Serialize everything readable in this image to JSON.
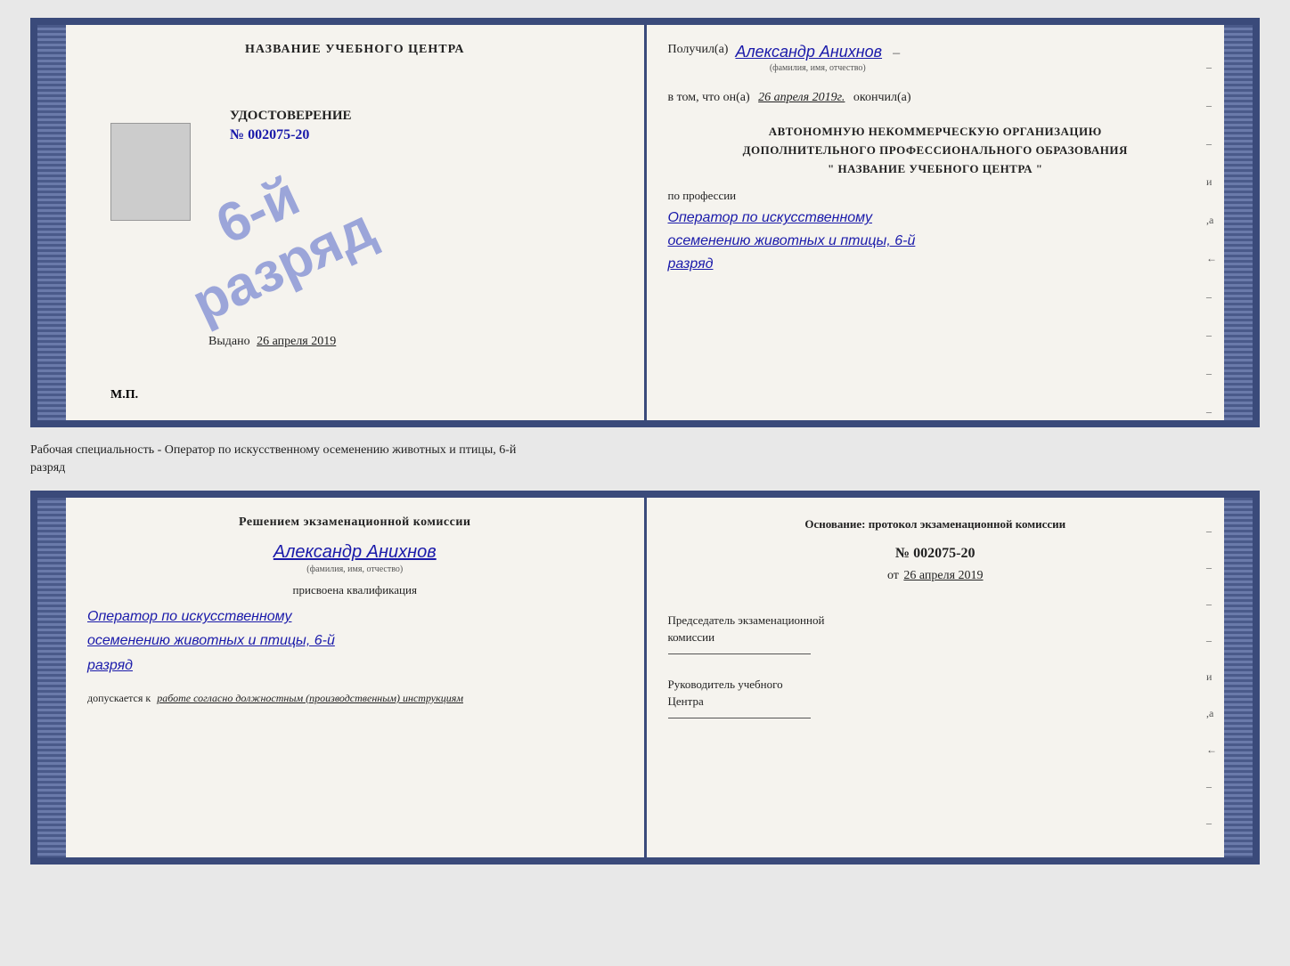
{
  "top_doc": {
    "left": {
      "header": "НАЗВАНИЕ УЧЕБНОГО ЦЕНТРА",
      "udostoverenie_label": "УДОСТОВЕРЕНИЕ",
      "number": "№ 002075-20",
      "vydano_label": "Выдано",
      "vydano_date": "26 апреля 2019",
      "mp_label": "М.П.",
      "stamp_line1": "6-й",
      "stamp_line2": "разряд"
    },
    "right": {
      "poluchil_prefix": "Получил(а)",
      "poluchil_name": "Александр Анихнов",
      "fio_subtitle": "(фамилия, имя, отчество)",
      "dash1": "–",
      "vtom_prefix": "в том, что он(а)",
      "vtom_date": "26 апреля 2019г.",
      "okkonchil": "окончил(а)",
      "org_line1": "АВТОНОМНУЮ НЕКОММЕРЧЕСКУЮ ОРГАНИЗАЦИЮ",
      "org_line2": "ДОПОЛНИТЕЛЬНОГО ПРОФЕССИОНАЛЬНОГО ОБРАЗОВАНИЯ",
      "org_line3": "\"  НАЗВАНИЕ УЧЕБНОГО ЦЕНТРА  \"",
      "po_professii": "по профессии",
      "professiya1": "Оператор по искусственному",
      "professiya2": "осеменению животных и птицы, 6-й",
      "professiya3": "разряд",
      "dashes": [
        "–",
        "–",
        "–",
        "и",
        ",а",
        "←",
        "–",
        "–",
        "–",
        "–"
      ]
    }
  },
  "between_label": "Рабочая специальность - Оператор по искусственному осеменению животных и птицы, 6-й\nразряд",
  "bottom_doc": {
    "left": {
      "resheniyem": "Решением экзаменационной комиссии",
      "person_name": "Александр Анихнов",
      "fio_subtitle": "(фамилия, имя, отчество)",
      "prisvoena": "присвоена квалификация",
      "kvali1": "Оператор по искусственному",
      "kvali2": "осеменению животных и птицы, 6-й",
      "kvali3": "разряд",
      "dopusk_prefix": "допускается к",
      "dopusk_text": "работе согласно должностным (производственным) инструкциям"
    },
    "right": {
      "osnovanie": "Основание: протокол экзаменационной комиссии",
      "protocol_num": "№ 002075-20",
      "ot_prefix": "от",
      "ot_date": "26 апреля 2019",
      "predsedatel_line1": "Председатель экзаменационной",
      "predsedatel_line2": "комиссии",
      "rukovoditel_line1": "Руководитель учебного",
      "rukovoditel_line2": "Центра",
      "dashes": [
        "–",
        "–",
        "–",
        "–",
        "и",
        ",а",
        "←",
        "–",
        "–",
        "–",
        "–",
        "–"
      ]
    }
  }
}
